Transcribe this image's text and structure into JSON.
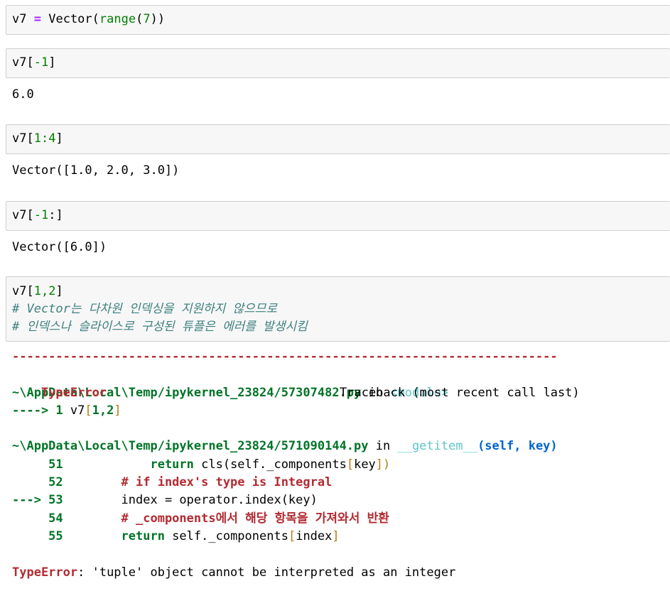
{
  "cells": [
    {
      "code": {
        "var": "v7",
        "op": "=",
        "cls": "Vector(",
        "fn": "range",
        "open": "(",
        "arg": "7",
        "close": "))"
      }
    },
    {
      "code": {
        "var": "v7[",
        "idx": "-1",
        "close": "]"
      },
      "output": "6.0"
    },
    {
      "code": {
        "var": "v7[",
        "idx": "1:4",
        "close": "]"
      },
      "output": "Vector([1.0, 2.0, 3.0])"
    },
    {
      "code": {
        "var": "v7[",
        "idx": "-1",
        "rest": ":]"
      },
      "output": "Vector([6.0])"
    },
    {
      "code": {
        "var": "v7[",
        "idx": "1,2",
        "close": "]"
      },
      "comments": [
        "# Vector는 다차원 인덱싱을 지원하지 않으므로",
        "# 인덱스나 슬라이스로 구성된 튜플은 에러를 발생시킴"
      ]
    }
  ],
  "traceback": {
    "separator": "---------------------------------------------------------------------------",
    "error_type": "TypeError",
    "header_right": "Traceback (most recent call last)",
    "frame1": {
      "path": "~\\AppData\\Local\\Temp/ipykernel_23824/57307482.py",
      "in": " in ",
      "where": "<module>",
      "arrow": "----> 1 ",
      "code_pre": "v7",
      "bracket_open": "[",
      "args": "1,2",
      "bracket_close": "]"
    },
    "frame2": {
      "path": "~\\AppData\\Local\\Temp/ipykernel_23824/571090144.py",
      "in": " in ",
      "func": "__getitem__",
      "sig": "(self, key)",
      "lines": [
        {
          "marker": "     51",
          "code_a": "            return",
          "code_b": " cls(self._components",
          "code_c": "[",
          "code_d": "key",
          "code_e": "])"
        },
        {
          "marker": "     52",
          "comment": "        # if index's type is Integral"
        },
        {
          "marker": "---> 53",
          "code": "        index = operator.index(key)"
        },
        {
          "marker": "     54",
          "comment": "        # _components에서 해당 항목을 가져와서 반환"
        },
        {
          "marker": "     55",
          "code_a": "        return",
          "code_b": " self._components",
          "code_c": "[",
          "code_d": "index",
          "code_e": "]"
        }
      ]
    },
    "final_type": "TypeError",
    "final_msg": ": 'tuple' object cannot be interpreted as an integer"
  }
}
